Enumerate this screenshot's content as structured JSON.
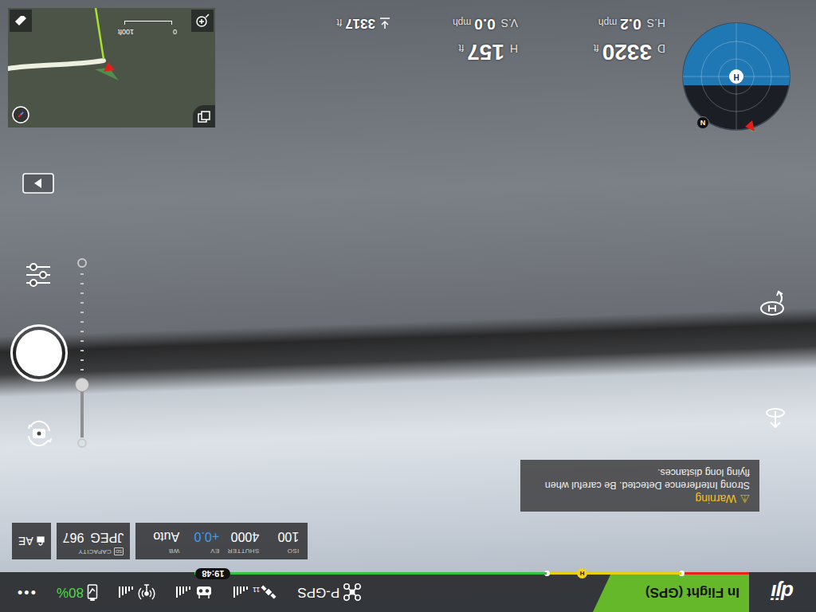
{
  "status_bar": {
    "logo": "dji",
    "flight_status": "In Flight (GPS)",
    "flight_mode": "P-GPS",
    "gps": {
      "satellites": "11",
      "level": 1
    },
    "remote_signal": {
      "level": 1
    },
    "video_signal": {
      "level": 1
    },
    "battery": {
      "percent": "80%"
    },
    "menu": "•••"
  },
  "battery_timeline": {
    "segments": [
      {
        "level": 0.09,
        "color": "#e5231b"
      },
      {
        "level": 0.18,
        "color": "#e8d20f"
      },
      {
        "level": 0.47,
        "color": "#35c23f"
      }
    ],
    "home_marker": "H",
    "time": "19:48"
  },
  "camera_settings": {
    "items": [
      {
        "label": "ISO",
        "value": "100",
        "color": "#ffffff"
      },
      {
        "label": "SHUTTER",
        "value": "4000",
        "color": "#ffffff"
      },
      {
        "label": "EV",
        "value": "+0.0",
        "color": "#3d9cf0"
      },
      {
        "label": "WB",
        "value": "Auto",
        "color": "#ffffff"
      }
    ],
    "storage": {
      "card": "SD",
      "label": "CAPACITY",
      "format": "JPEG",
      "count": "967"
    },
    "ae_lock": {
      "label": "AE"
    }
  },
  "warning": {
    "icon": "⚠",
    "title": "Warning",
    "message": "Strong Interference Detected. Be careful when flying long distances."
  },
  "telemetry": {
    "rows": [
      [
        {
          "kind": "label",
          "label": "D",
          "value": "3320",
          "unit": "ft"
        },
        {
          "kind": "label",
          "label": "H",
          "value": "157",
          "unit": "ft"
        }
      ],
      [
        {
          "kind": "label",
          "label": "H.S",
          "value": "0.2",
          "unit": "mph"
        },
        {
          "kind": "label",
          "label": "V.S",
          "value": "0.0",
          "unit": "mph"
        },
        {
          "kind": "icon",
          "value": "3317",
          "unit": "ft"
        }
      ]
    ]
  },
  "exposure_slider": {
    "level": 0.31
  },
  "radar": {
    "home": "H",
    "north": "N",
    "level": 0.58
  },
  "map": {
    "scale_start": "0",
    "scale_end": "100ft"
  }
}
